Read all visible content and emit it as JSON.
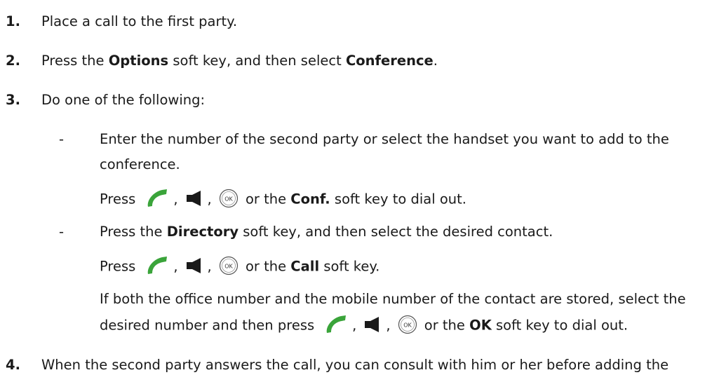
{
  "steps": {
    "s1": {
      "num": "1.",
      "text": "Place a call to the first party."
    },
    "s2": {
      "num": "2.",
      "pre": "Press the ",
      "b1": "Options",
      "mid": " soft key, and then select ",
      "b2": "Conference",
      "post": "."
    },
    "s3": {
      "num": "3.",
      "text": "Do one of the following:"
    },
    "s4": {
      "num": "4.",
      "text": "When the second party answers the call, you can consult with him or her before adding the"
    }
  },
  "options": {
    "dash": "-",
    "a": {
      "line1": "Enter the number of the second party or select the handset you want to add to the",
      "line2": "conference.",
      "press": "Press",
      "comma": ",",
      "or_the": "or the",
      "key": "Conf.",
      "tail": "soft key to dial out."
    },
    "b": {
      "pre": "Press the ",
      "key": "Directory",
      "post": " soft key, and then select the desired contact.",
      "press": "Press",
      "comma": ",",
      "or_the": "or the",
      "key2": "Call",
      "tail": "soft key.",
      "note1": "If both the office number and the mobile number of the contact are stored, select the",
      "note2_pre": "desired number and then press",
      "note2_or": "or the",
      "note2_key": "OK",
      "note2_tail": "soft key to dial out."
    }
  },
  "icons": {
    "handset": "green-handset-icon",
    "speaker": "speakerphone-icon",
    "ok": "ok-key-icon",
    "ok_text": "OK",
    "handset_color": "#3aa43a"
  }
}
